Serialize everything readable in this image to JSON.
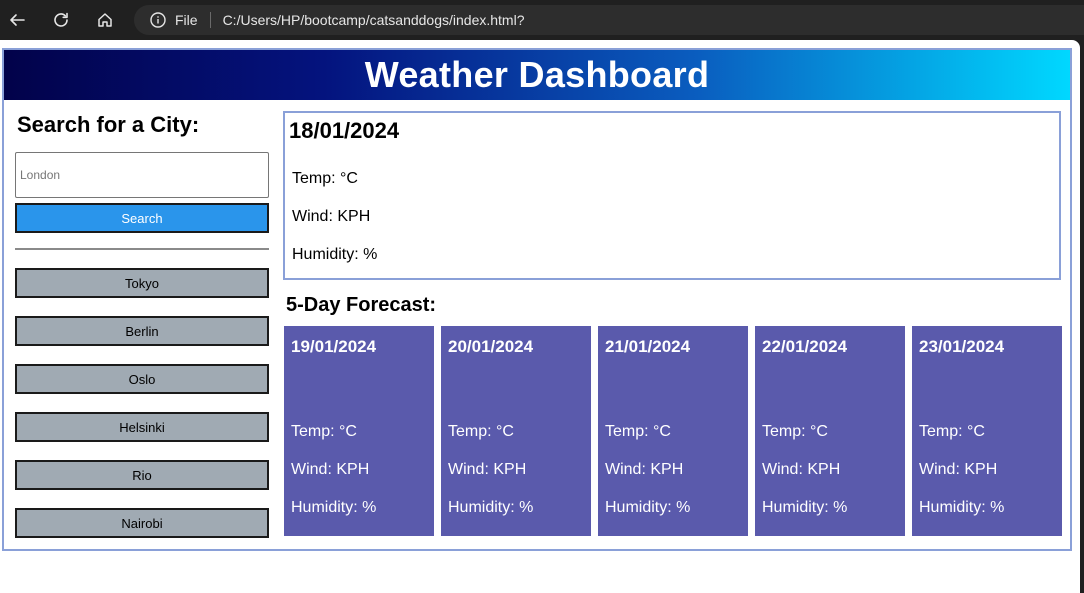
{
  "browser": {
    "file_label": "File",
    "url": "C:/Users/HP/bootcamp/catsanddogs/index.html?"
  },
  "header": {
    "title": "Weather Dashboard"
  },
  "sidebar": {
    "heading": "Search for a City:",
    "search_placeholder": "London",
    "search_button": "Search",
    "history": [
      "Tokyo",
      "Berlin",
      "Oslo",
      "Helsinki",
      "Rio",
      "Nairobi"
    ]
  },
  "current": {
    "date": "18/01/2024",
    "temp": "Temp: °C",
    "wind": "Wind: KPH",
    "humidity": "Humidity: %"
  },
  "forecast": {
    "title": "5-Day Forecast:",
    "days": [
      {
        "date": "19/01/2024",
        "temp": "Temp: °C",
        "wind": "Wind: KPH",
        "humidity": "Humidity: %"
      },
      {
        "date": "20/01/2024",
        "temp": "Temp: °C",
        "wind": "Wind: KPH",
        "humidity": "Humidity: %"
      },
      {
        "date": "21/01/2024",
        "temp": "Temp: °C",
        "wind": "Wind: KPH",
        "humidity": "Humidity: %"
      },
      {
        "date": "22/01/2024",
        "temp": "Temp: °C",
        "wind": "Wind: KPH",
        "humidity": "Humidity: %"
      },
      {
        "date": "23/01/2024",
        "temp": "Temp: °C",
        "wind": "Wind: KPH",
        "humidity": "Humidity: %"
      }
    ]
  },
  "colors": {
    "search_button": "#2a95eb",
    "history_button": "#a0aab3",
    "forecast_card": "#5a5aac",
    "border": "#8aa0d8"
  }
}
